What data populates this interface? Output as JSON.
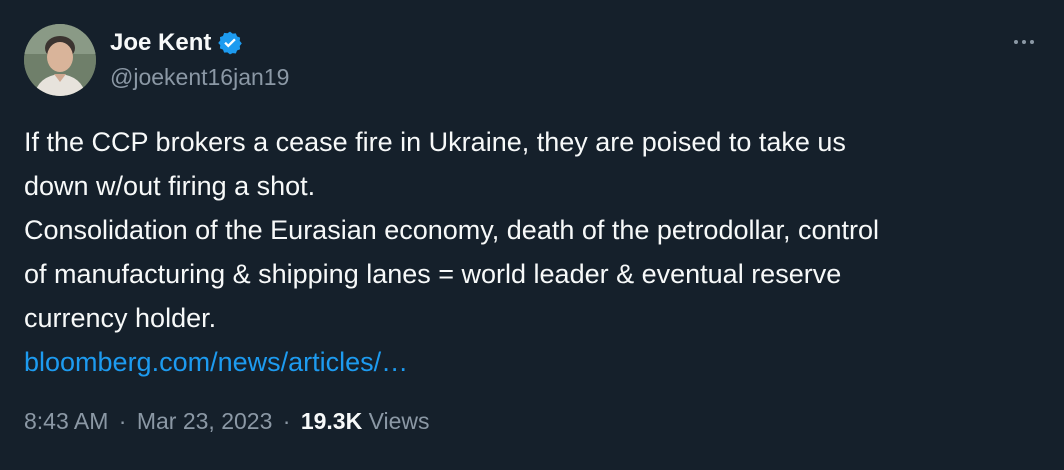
{
  "author": {
    "display_name": "Joe Kent",
    "handle": "@joekent16jan19",
    "verified": true,
    "verified_color": "#1d9bf0"
  },
  "tweet": {
    "lines": [
      "If the CCP brokers a cease fire in Ukraine, they are poised to take us",
      "down w/out firing a shot.",
      "Consolidation of the Eurasian economy, death of the petrodollar, control",
      "of manufacturing & shipping lanes = world leader & eventual reserve",
      "currency holder."
    ],
    "link_text": "bloomberg.com/news/articles/…"
  },
  "meta": {
    "time": "8:43 AM",
    "separator": "·",
    "date": "Mar 23, 2023",
    "views_count": "19.3K",
    "views_label": "Views"
  },
  "colors": {
    "background": "#15202b",
    "text": "#f7f9f9",
    "secondary": "#8b98a5",
    "link": "#1d9bf0"
  },
  "icons": {
    "more": "more-horizontal-icon",
    "verified": "verified-badge-icon"
  }
}
